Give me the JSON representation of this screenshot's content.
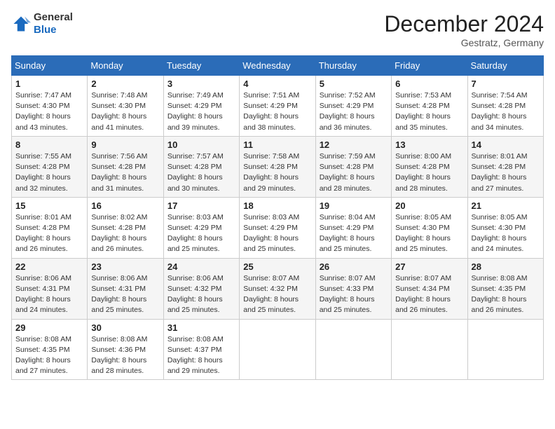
{
  "logo": {
    "line1": "General",
    "line2": "Blue"
  },
  "header": {
    "month_year": "December 2024",
    "location": "Gestratz, Germany"
  },
  "days_of_week": [
    "Sunday",
    "Monday",
    "Tuesday",
    "Wednesday",
    "Thursday",
    "Friday",
    "Saturday"
  ],
  "weeks": [
    [
      {
        "day": 1,
        "sunrise": "7:47 AM",
        "sunset": "4:30 PM",
        "daylight": "8 hours and 43 minutes."
      },
      {
        "day": 2,
        "sunrise": "7:48 AM",
        "sunset": "4:30 PM",
        "daylight": "8 hours and 41 minutes."
      },
      {
        "day": 3,
        "sunrise": "7:49 AM",
        "sunset": "4:29 PM",
        "daylight": "8 hours and 39 minutes."
      },
      {
        "day": 4,
        "sunrise": "7:51 AM",
        "sunset": "4:29 PM",
        "daylight": "8 hours and 38 minutes."
      },
      {
        "day": 5,
        "sunrise": "7:52 AM",
        "sunset": "4:29 PM",
        "daylight": "8 hours and 36 minutes."
      },
      {
        "day": 6,
        "sunrise": "7:53 AM",
        "sunset": "4:28 PM",
        "daylight": "8 hours and 35 minutes."
      },
      {
        "day": 7,
        "sunrise": "7:54 AM",
        "sunset": "4:28 PM",
        "daylight": "8 hours and 34 minutes."
      }
    ],
    [
      {
        "day": 8,
        "sunrise": "7:55 AM",
        "sunset": "4:28 PM",
        "daylight": "8 hours and 32 minutes."
      },
      {
        "day": 9,
        "sunrise": "7:56 AM",
        "sunset": "4:28 PM",
        "daylight": "8 hours and 31 minutes."
      },
      {
        "day": 10,
        "sunrise": "7:57 AM",
        "sunset": "4:28 PM",
        "daylight": "8 hours and 30 minutes."
      },
      {
        "day": 11,
        "sunrise": "7:58 AM",
        "sunset": "4:28 PM",
        "daylight": "8 hours and 29 minutes."
      },
      {
        "day": 12,
        "sunrise": "7:59 AM",
        "sunset": "4:28 PM",
        "daylight": "8 hours and 28 minutes."
      },
      {
        "day": 13,
        "sunrise": "8:00 AM",
        "sunset": "4:28 PM",
        "daylight": "8 hours and 28 minutes."
      },
      {
        "day": 14,
        "sunrise": "8:01 AM",
        "sunset": "4:28 PM",
        "daylight": "8 hours and 27 minutes."
      }
    ],
    [
      {
        "day": 15,
        "sunrise": "8:01 AM",
        "sunset": "4:28 PM",
        "daylight": "8 hours and 26 minutes."
      },
      {
        "day": 16,
        "sunrise": "8:02 AM",
        "sunset": "4:28 PM",
        "daylight": "8 hours and 26 minutes."
      },
      {
        "day": 17,
        "sunrise": "8:03 AM",
        "sunset": "4:29 PM",
        "daylight": "8 hours and 25 minutes."
      },
      {
        "day": 18,
        "sunrise": "8:03 AM",
        "sunset": "4:29 PM",
        "daylight": "8 hours and 25 minutes."
      },
      {
        "day": 19,
        "sunrise": "8:04 AM",
        "sunset": "4:29 PM",
        "daylight": "8 hours and 25 minutes."
      },
      {
        "day": 20,
        "sunrise": "8:05 AM",
        "sunset": "4:30 PM",
        "daylight": "8 hours and 25 minutes."
      },
      {
        "day": 21,
        "sunrise": "8:05 AM",
        "sunset": "4:30 PM",
        "daylight": "8 hours and 24 minutes."
      }
    ],
    [
      {
        "day": 22,
        "sunrise": "8:06 AM",
        "sunset": "4:31 PM",
        "daylight": "8 hours and 24 minutes."
      },
      {
        "day": 23,
        "sunrise": "8:06 AM",
        "sunset": "4:31 PM",
        "daylight": "8 hours and 25 minutes."
      },
      {
        "day": 24,
        "sunrise": "8:06 AM",
        "sunset": "4:32 PM",
        "daylight": "8 hours and 25 minutes."
      },
      {
        "day": 25,
        "sunrise": "8:07 AM",
        "sunset": "4:32 PM",
        "daylight": "8 hours and 25 minutes."
      },
      {
        "day": 26,
        "sunrise": "8:07 AM",
        "sunset": "4:33 PM",
        "daylight": "8 hours and 25 minutes."
      },
      {
        "day": 27,
        "sunrise": "8:07 AM",
        "sunset": "4:34 PM",
        "daylight": "8 hours and 26 minutes."
      },
      {
        "day": 28,
        "sunrise": "8:08 AM",
        "sunset": "4:35 PM",
        "daylight": "8 hours and 26 minutes."
      }
    ],
    [
      {
        "day": 29,
        "sunrise": "8:08 AM",
        "sunset": "4:35 PM",
        "daylight": "8 hours and 27 minutes."
      },
      {
        "day": 30,
        "sunrise": "8:08 AM",
        "sunset": "4:36 PM",
        "daylight": "8 hours and 28 minutes."
      },
      {
        "day": 31,
        "sunrise": "8:08 AM",
        "sunset": "4:37 PM",
        "daylight": "8 hours and 29 minutes."
      },
      null,
      null,
      null,
      null
    ]
  ]
}
